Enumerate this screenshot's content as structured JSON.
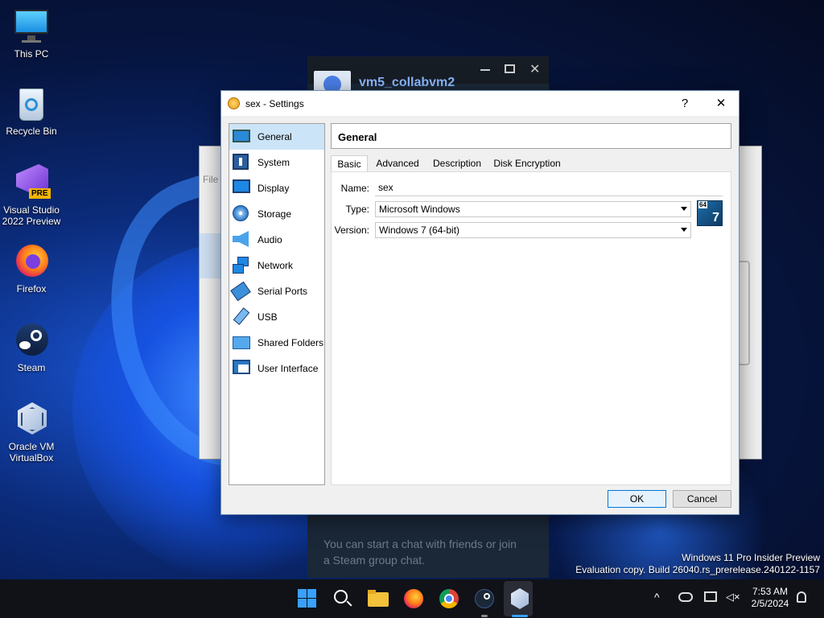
{
  "desktop": {
    "icons": [
      {
        "label": "This PC"
      },
      {
        "label": "Recycle Bin"
      },
      {
        "label": "Visual Studio 2022 Preview",
        "badge": "PRE"
      },
      {
        "label": "Firefox"
      },
      {
        "label": "Steam"
      },
      {
        "label": "Oracle VM VirtualBox"
      }
    ]
  },
  "steam": {
    "user": "vm5_collabvm2",
    "chat_hint": "You can start a chat with friends or join a Steam group chat."
  },
  "vbox_bg": {
    "menu_file": "File"
  },
  "dialog": {
    "title": "sex - Settings",
    "help": "?",
    "close": "✕",
    "categories": [
      {
        "label": "General",
        "icon": "general-icon"
      },
      {
        "label": "System",
        "icon": "system-icon"
      },
      {
        "label": "Display",
        "icon": "display-icon"
      },
      {
        "label": "Storage",
        "icon": "storage-icon"
      },
      {
        "label": "Audio",
        "icon": "audio-icon"
      },
      {
        "label": "Network",
        "icon": "network-icon"
      },
      {
        "label": "Serial Ports",
        "icon": "serial-ports-icon"
      },
      {
        "label": "USB",
        "icon": "usb-icon"
      },
      {
        "label": "Shared Folders",
        "icon": "shared-folders-icon"
      },
      {
        "label": "User Interface",
        "icon": "user-interface-icon"
      }
    ],
    "selected_category": "General",
    "header": "General",
    "tabs": [
      "Basic",
      "Advanced",
      "Description",
      "Disk Encryption"
    ],
    "active_tab": "Basic",
    "fields": {
      "name_label": "Name:",
      "name_value": "sex",
      "type_label": "Type:",
      "type_value": "Microsoft Windows",
      "version_label": "Version:",
      "version_value": "Windows 7 (64-bit)"
    },
    "os_badge": {
      "bits": "64",
      "version": "7"
    },
    "ok": "OK",
    "cancel": "Cancel"
  },
  "watermark": {
    "line1": "Windows 11 Pro Insider Preview",
    "line2": "Evaluation copy. Build 26040.rs_prerelease.240122-1157"
  },
  "taskbar": {
    "time": "7:53 AM",
    "date": "2/5/2024",
    "apps": [
      "start-icon",
      "search-icon",
      "file-explorer-icon",
      "firefox-icon",
      "chrome-icon",
      "steam-icon",
      "virtualbox-icon"
    ]
  },
  "colors": {
    "accent": "#0078d7",
    "selection": "#cce4f7",
    "taskbar": "#101218"
  }
}
